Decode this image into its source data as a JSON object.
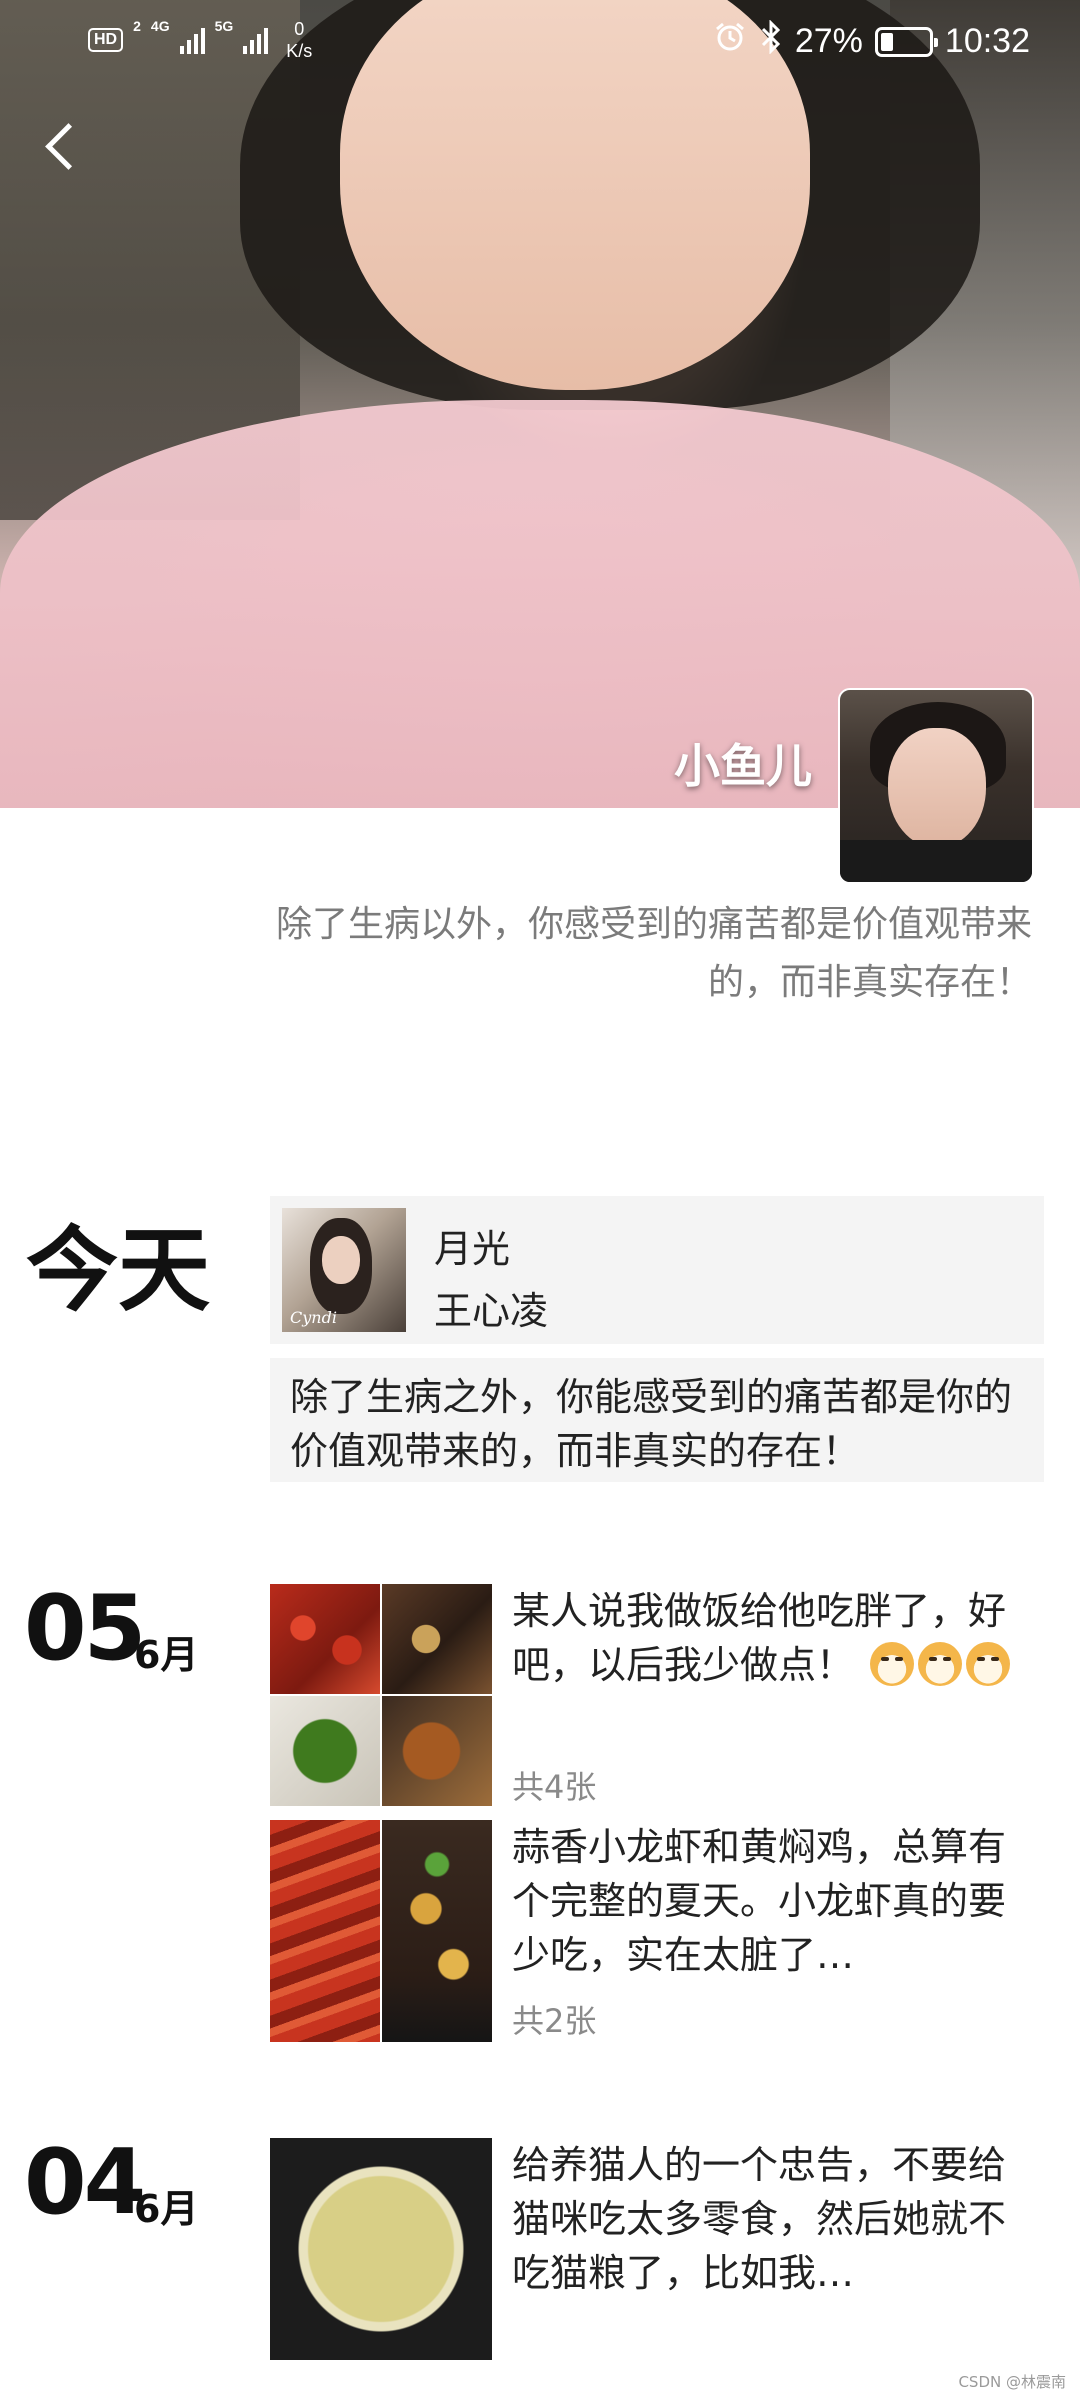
{
  "status_bar": {
    "hd_badge": "HD",
    "sim_slot": "2",
    "net_1": "4G",
    "net_2": "5G",
    "speed_value": "0",
    "speed_unit": "K/s",
    "battery_percent": "27%",
    "battery_level": 0.27,
    "time": "10:32",
    "icons": [
      "alarm-icon",
      "bluetooth-icon",
      "battery-icon",
      "signal-icon"
    ]
  },
  "profile": {
    "name": "小鱼儿",
    "signature": "除了生病以外，你感受到的痛苦都是价值观带来的，而非真实存在！"
  },
  "today": {
    "label": "今天",
    "music": {
      "title": "月光",
      "artist": "王心凌",
      "cover_text": "Cyndi"
    },
    "text": "除了生病之外，你能感受到的痛苦都是你的价值观带来的，而非真实的存在！"
  },
  "day_05": {
    "day": "05",
    "month": "6月",
    "posts": [
      {
        "text": "某人说我做饭给他吃胖了，好吧，以后我少做点！",
        "count": "共4张",
        "emojis": [
          "doge-emoji",
          "doge-emoji",
          "doge-emoji"
        ]
      },
      {
        "text": "蒜香小龙虾和黄焖鸡，总算有个完整的夏天。小龙虾真的要少吃，实在太脏了…",
        "count": "共2张"
      }
    ]
  },
  "day_04": {
    "day": "04",
    "month": "6月",
    "posts": [
      {
        "text": "给养猫人的一个忠告，不要给猫咪吃太多零食，然后她就不吃猫粮了，比如我…"
      }
    ]
  },
  "watermark": "CSDN @林震南",
  "colors": {
    "text_primary": "#222222",
    "text_secondary": "#7b7b7b",
    "card_bg": "#f4f4f4",
    "count_text": "#8a8a8a"
  }
}
